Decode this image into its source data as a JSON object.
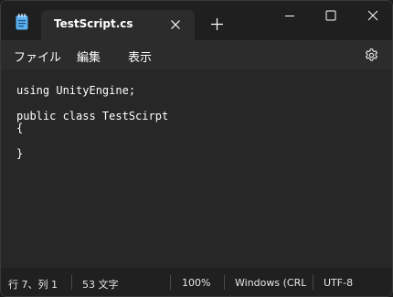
{
  "tab": {
    "title": "TestScript.cs"
  },
  "menu": {
    "file": "ファイル",
    "edit": "編集",
    "view": "表示"
  },
  "editor": {
    "content": "using UnityEngine;\n\npublic class TestScirpt\n{\n\n}"
  },
  "status": {
    "position": "行 7、列 1",
    "char_count": "53 文字",
    "zoom": "100%",
    "line_ending": "Windows (CRLF)",
    "encoding": "UTF-8"
  },
  "icons": {
    "app": "notepad-icon",
    "tab_close": "close-icon",
    "new_tab": "plus-icon",
    "minimize": "minimize-icon",
    "maximize": "maximize-icon",
    "close": "close-icon",
    "settings": "gear-icon"
  },
  "colors": {
    "background": "#272727",
    "titlebar": "#1f1f1f",
    "accent_icon": "#5ab0f0"
  }
}
